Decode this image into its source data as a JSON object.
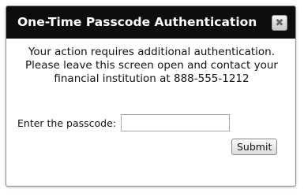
{
  "dialog": {
    "title": "One-Time Passcode Authentication",
    "close_icon": "close-icon",
    "close_glyph": "✖",
    "message_lines": [
      "Your action requires additional authentication.",
      "Please leave this screen open and contact your",
      "financial institution at 888-555-1212"
    ],
    "passcode": {
      "label": "Enter the passcode:",
      "value": "",
      "placeholder": ""
    },
    "submit_label": "Submit"
  },
  "colors": {
    "titlebar_bg": "#0d0d0d",
    "titlebar_text": "#ffffff",
    "dialog_border": "#8f8f8f"
  }
}
